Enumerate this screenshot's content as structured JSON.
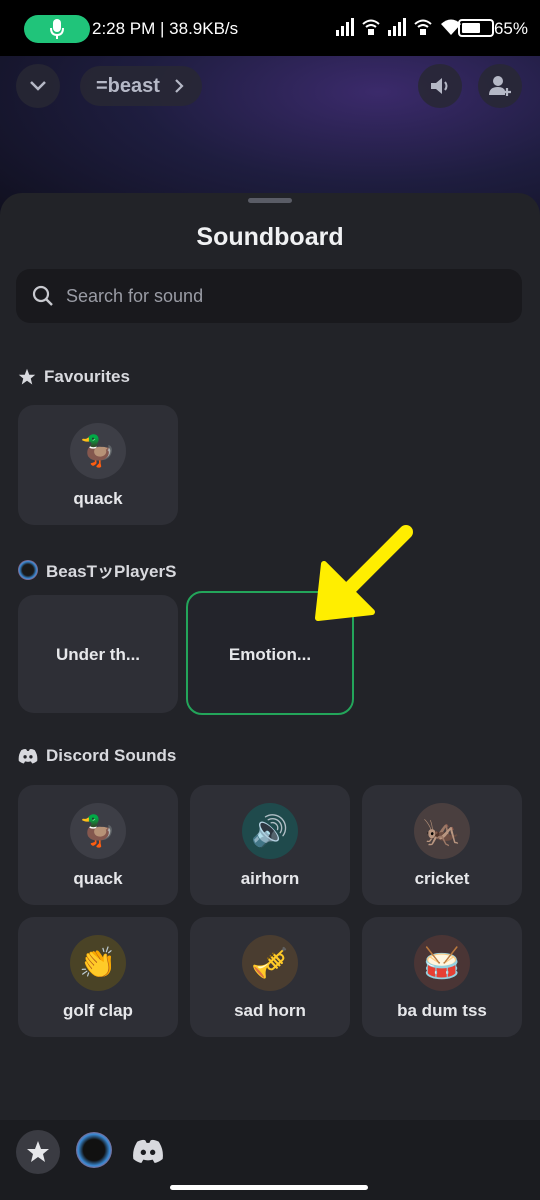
{
  "status_bar": {
    "time_and_speed": "2:28 PM | 38.9KB/s",
    "battery": "65%",
    "battery_level": 0.65,
    "mic_indicator_color": "#20c47a"
  },
  "call_header": {
    "channel_name": "=beast",
    "collapse_icon": "chevron-down-icon",
    "speaker_icon": "speaker-icon",
    "add_member_icon": "add-member-icon"
  },
  "sheet": {
    "title": "Soundboard",
    "search_placeholder": "Search for sound"
  },
  "sections": {
    "favourites": {
      "title": "Favourites",
      "icon": "star-icon",
      "items": [
        {
          "label": "quack",
          "icon": "duck-icon",
          "glyph": "🦆"
        }
      ]
    },
    "server": {
      "title": "BeasTッPlayerS",
      "icon": "server-avatar-icon",
      "items": [
        {
          "label": "Under th..."
        },
        {
          "label": "Emotion..."
        }
      ]
    },
    "discord": {
      "title": "Discord Sounds",
      "icon": "discord-icon",
      "items": [
        {
          "label": "quack",
          "icon": "duck-icon",
          "glyph": "🦆"
        },
        {
          "label": "airhorn",
          "icon": "speaker-icon",
          "glyph": "🔊"
        },
        {
          "label": "cricket",
          "icon": "cricket-icon",
          "glyph": "🦗"
        },
        {
          "label": "golf clap",
          "icon": "clapping-hands-icon",
          "glyph": "👏"
        },
        {
          "label": "sad horn",
          "icon": "trumpet-icon",
          "glyph": "🎺"
        },
        {
          "label": "ba dum tss",
          "icon": "drum-icon",
          "glyph": "🥁"
        }
      ]
    }
  },
  "bottom_tabs": [
    {
      "icon": "star-icon"
    },
    {
      "icon": "server-avatar-icon"
    },
    {
      "icon": "discord-icon"
    }
  ],
  "colors": {
    "sheet_bg": "#222328",
    "tile_bg": "#2e2f36",
    "selected_border": "#23a55a",
    "annotation_arrow": "#ffee00"
  }
}
